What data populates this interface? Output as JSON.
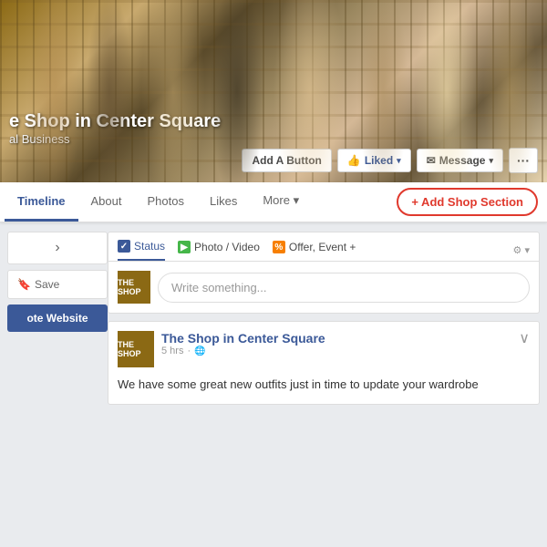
{
  "cover": {
    "page_name": "e Shop in Center Square",
    "page_type": "al Business"
  },
  "cover_buttons": {
    "add_button": "Add A Button",
    "liked": "Liked",
    "message": "Message",
    "dots": "···"
  },
  "nav": {
    "tabs": [
      {
        "label": "Timeline",
        "active": true
      },
      {
        "label": "About",
        "active": false
      },
      {
        "label": "Photos",
        "active": false
      },
      {
        "label": "Likes",
        "active": false
      },
      {
        "label": "More",
        "active": false,
        "has_caret": true
      }
    ],
    "add_shop_section": "+ Add Shop Section"
  },
  "sidebar": {
    "arrow_icon": "›",
    "save_icon": "🔖",
    "save_label": "Save",
    "promote_label": "ote Website"
  },
  "post_box": {
    "status_tab": "Status",
    "photo_tab": "Photo / Video",
    "offer_tab": "Offer, Event +",
    "placeholder": "Write something...",
    "avatar_text": "THE SHOP"
  },
  "feed_post": {
    "page_name": "The Shop in Center Square",
    "time": "5 hrs",
    "privacy": "🌐",
    "body": "We have some great new outfits just in time to update your wardrobe",
    "avatar_text": "THE SHOP",
    "collapse_icon": "∨"
  }
}
